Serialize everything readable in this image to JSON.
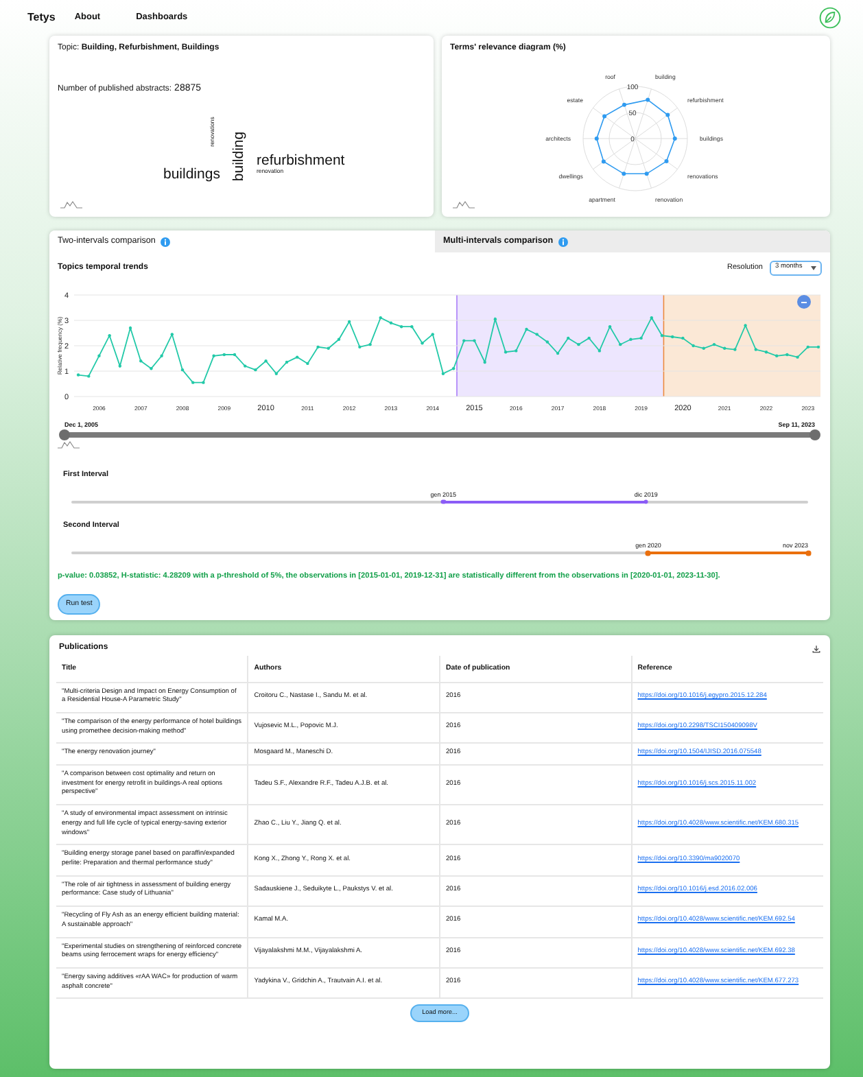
{
  "nav": {
    "logo": "Tetys",
    "links": [
      {
        "label": "About"
      },
      {
        "label": "Dashboards"
      }
    ]
  },
  "topic_card": {
    "topic_line": "Topic: **Building, Refurbishment, Buildings**",
    "count_label": "Number of published abstracts:",
    "count": "28875",
    "word_cloud": [
      {
        "word": "buildings",
        "vertical": false
      },
      {
        "word": "building",
        "vertical": true
      },
      {
        "word": "renovations",
        "vertical": true
      },
      {
        "word": "refurbishment",
        "vertical": false
      },
      {
        "word": "renovation",
        "vertical": false
      }
    ]
  },
  "relevance_card": {
    "title": "Terms' relevance diagram (%)",
    "chart_data": {
      "type": "radar",
      "categories": [
        "building",
        "refurbishment",
        "buildings",
        "renovations",
        "renovation",
        "apartment",
        "dwellings",
        "architects",
        "estate",
        "roof"
      ],
      "values": [
        78,
        77,
        76,
        74,
        71,
        71,
        75,
        74,
        73,
        68
      ],
      "ylim": [
        0,
        100
      ],
      "yticks": [
        0,
        50,
        100
      ]
    }
  },
  "comparison": {
    "tabs": [
      {
        "label": "Two-intervals comparison",
        "selected": true
      },
      {
        "label": "Multi-intervals comparison",
        "selected": false
      }
    ],
    "title": "Topics temporal trends",
    "resolution_label": "Resolution",
    "resolution": "3 months",
    "chart_data": {
      "type": "line",
      "ylabel": "Relative frequency (%)",
      "x": [
        2005.5,
        2005.75,
        2006,
        2006.25,
        2006.5,
        2006.75,
        2007,
        2007.25,
        2007.5,
        2007.75,
        2008,
        2008.25,
        2008.5,
        2008.75,
        2009,
        2009.25,
        2009.5,
        2009.75,
        2010,
        2010.25,
        2010.5,
        2010.75,
        2011,
        2011.25,
        2011.5,
        2011.75,
        2012,
        2012.25,
        2012.5,
        2012.75,
        2013,
        2013.25,
        2013.5,
        2013.75,
        2014,
        2014.25,
        2014.5,
        2014.75,
        2015,
        2015.25,
        2015.5,
        2015.75,
        2016,
        2016.25,
        2016.5,
        2016.75,
        2017,
        2017.25,
        2017.5,
        2017.75,
        2018,
        2018.25,
        2018.5,
        2018.75,
        2019,
        2019.25,
        2019.5,
        2019.75,
        2020,
        2020.25,
        2020.5,
        2020.75,
        2021,
        2021.25,
        2021.5,
        2021.75,
        2022,
        2022.25,
        2022.5,
        2022.75,
        2023,
        2023.25
      ],
      "series": [
        {
          "color": "#22c9a8",
          "values": [
            0.85,
            0.8,
            1.6,
            2.4,
            1.2,
            2.7,
            1.4,
            1.1,
            1.6,
            2.45,
            1.05,
            0.55,
            0.55,
            1.6,
            1.65,
            1.65,
            1.2,
            1.05,
            1.4,
            0.9,
            1.35,
            1.55,
            1.3,
            1.95,
            1.9,
            2.25,
            2.95,
            1.95,
            2.05,
            3.1,
            2.9,
            2.75,
            2.75,
            2.1,
            2.45,
            0.9,
            1.1,
            2.2,
            2.2,
            1.35,
            3.05,
            1.75,
            1.8,
            2.65,
            2.45,
            2.15,
            1.7,
            2.3,
            2.05,
            2.3,
            1.8,
            2.75,
            2.05,
            2.25,
            2.3,
            3.1,
            2.4,
            2.35,
            2.3,
            2.0,
            1.9,
            2.05,
            1.9,
            1.85,
            2.8,
            1.85,
            1.75,
            1.6,
            1.65,
            1.55,
            1.95,
            1.95
          ]
        }
      ],
      "xlim": [
        2005.4,
        2023.3
      ],
      "ylim": [
        0,
        4
      ],
      "yticks": [
        0,
        1,
        2,
        3,
        4
      ],
      "xticks": [
        {
          "value": 2006,
          "label": "2006"
        },
        {
          "value": 2007,
          "label": "2007"
        },
        {
          "value": 2008,
          "label": "2008"
        },
        {
          "value": 2009,
          "label": "2009"
        },
        {
          "value": 2010,
          "label": "2010"
        },
        {
          "value": 2011,
          "label": "2011"
        },
        {
          "value": 2012,
          "label": "2012"
        },
        {
          "value": 2013,
          "label": "2013"
        },
        {
          "value": 2014,
          "label": "2014"
        },
        {
          "value": 2015,
          "label": "2015"
        },
        {
          "value": 2016,
          "label": "2016"
        },
        {
          "value": 2017,
          "label": "2017"
        },
        {
          "value": 2018,
          "label": "2018"
        },
        {
          "value": 2019,
          "label": "2019"
        },
        {
          "value": 2020,
          "label": "2020"
        },
        {
          "value": 2021,
          "label": "2021"
        },
        {
          "value": 2022,
          "label": "2022"
        },
        {
          "value": 2023,
          "label": "2023"
        }
      ],
      "grid": true,
      "bands": [
        {
          "from": 2014.58,
          "to": 2019.54,
          "axis": "x",
          "color": "#ede6fe"
        },
        {
          "from": 2019.54,
          "to": 2023.3,
          "axis": "x",
          "color": "#fbe8d6"
        }
      ],
      "ref_lines": [
        {
          "value": 2014.58,
          "axis": "x",
          "color": "#a97cf8"
        },
        {
          "value": 2019.54,
          "axis": "x",
          "color": "#ec8a3e"
        }
      ]
    },
    "range": {
      "thumbs": [
        {
          "label": "Dec 1, 2005",
          "level": 0
        },
        {
          "label": "Sep 11, 2023",
          "level": 1
        }
      ]
    },
    "intervals": [
      {
        "label": "First Interval",
        "color": "#8b5cf6",
        "thumbs": [
          {
            "label": "gen 2015",
            "level": 0.505
          },
          {
            "label": "dic 2019",
            "level": 0.78
          }
        ]
      },
      {
        "label": "Second Interval",
        "color": "#ea6f0c",
        "thumbs": [
          {
            "label": "gen 2020",
            "level": 0.783
          },
          {
            "label": "nov 2023",
            "level": 1
          }
        ]
      }
    ],
    "result": "p-value: 0.03852, H-statistic: 4.28209 with a p-threshold of 5%, the observations in [2015-01-01, 2019-12-31] **are statistically different** from the observations in [2020-01-01, 2023-11-30].",
    "run_button": "Run test"
  },
  "publications": {
    "title": "Publications",
    "columns": [
      "Title",
      "Authors",
      "Date of publication",
      "Reference"
    ],
    "rows": [
      {
        "title": "\"Multi-criteria Design and Impact on Energy Consumption of a Residential House-A Parametric Study\"",
        "authors": "Croitoru C., Nastase I., Sandu M. et al.",
        "date": "2016",
        "reference": "https://doi.org/10.1016/j.egypro.2015.12.284"
      },
      {
        "title": "\"The comparison of the energy performance of hotel buildings using promethee decision-making method\"",
        "authors": "Vujosevic M.L., Popovic M.J.",
        "date": "2016",
        "reference": "https://doi.org/10.2298/TSCI150409098V"
      },
      {
        "title": "\"The energy renovation journey\"",
        "authors": "Mosgaard M., Maneschi D.",
        "date": "2016",
        "reference": "https://doi.org/10.1504/IJISD.2016.075548"
      },
      {
        "title": "\"A comparison between cost optimality and return on investment for energy retrofit in buildings-A real options perspective\"",
        "authors": "Tadeu S.F., Alexandre R.F., Tadeu A.J.B. et al.",
        "date": "2016",
        "reference": "https://doi.org/10.1016/j.scs.2015.11.002"
      },
      {
        "title": "\"A study of environmental impact assessment on intrinsic energy and full life cycle of typical energy-saving exterior windows\"",
        "authors": "Zhao C., Liu Y., Jiang Q. et al.",
        "date": "2016",
        "reference": "https://doi.org/10.4028/www.scientific.net/KEM.680.315"
      },
      {
        "title": "\"Building energy storage panel based on paraffin/expanded perlite: Preparation and thermal performance study\"",
        "authors": "Kong X., Zhong Y., Rong X. et al.",
        "date": "2016",
        "reference": "https://doi.org/10.3390/ma9020070"
      },
      {
        "title": "\"The role of air tightness in assessment of building energy performance: Case study of Lithuania\"",
        "authors": "Sadauskiene J., Seduikyte L., Paukstys V. et al.",
        "date": "2016",
        "reference": "https://doi.org/10.1016/j.esd.2016.02.006"
      },
      {
        "title": "\"Recycling of Fly Ash as an energy efficient building material: A sustainable approach\"",
        "authors": "Kamal M.A.",
        "date": "2016",
        "reference": "https://doi.org/10.4028/www.scientific.net/KEM.692.54"
      },
      {
        "title": "\"Experimental studies on strengthening of reinforced concrete beams using ferrocement wraps for energy efficiency\"",
        "authors": "Vijayalakshmi M.M., Vijayalakshmi A.",
        "date": "2016",
        "reference": "https://doi.org/10.4028/www.scientific.net/KEM.692.38"
      },
      {
        "title": "\"Energy saving additives «rAA WAC» for production of warm asphalt concrete\"",
        "authors": "Yadykina V., Gridchin A., Trautvain A.I. et al.",
        "date": "2016",
        "reference": "https://doi.org/10.4028/www.scientific.net/KEM.677.273"
      }
    ],
    "load_more": "Load more..."
  }
}
